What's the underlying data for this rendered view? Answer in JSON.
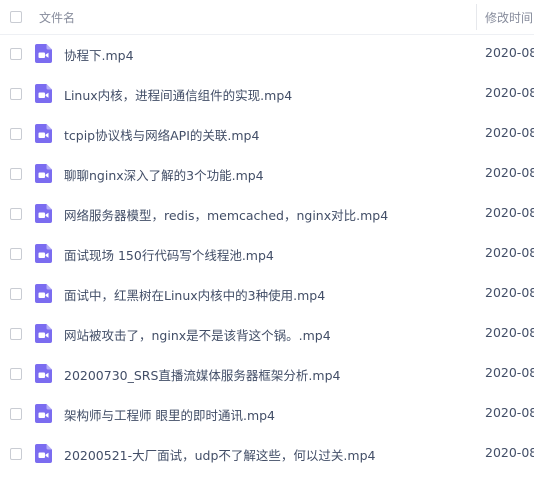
{
  "header": {
    "name_label": "文件名",
    "time_label": "修改时间"
  },
  "colors": {
    "video_icon": "#7b6cf0",
    "text": "#424e67",
    "header_text": "#878c9c"
  },
  "files": [
    {
      "name": "协程下.mp4",
      "modified": "2020-08-",
      "icon": "video-file-icon"
    },
    {
      "name": "Linux内核，进程间通信组件的实现.mp4",
      "modified": "2020-08-",
      "icon": "video-file-icon"
    },
    {
      "name": "tcpip协议栈与网络API的关联.mp4",
      "modified": "2020-08-",
      "icon": "video-file-icon"
    },
    {
      "name": "聊聊nginx深入了解的3个功能.mp4",
      "modified": "2020-08-",
      "icon": "video-file-icon"
    },
    {
      "name": "网络服务器模型，redis，memcached，nginx对比.mp4",
      "modified": "2020-08-",
      "icon": "video-file-icon"
    },
    {
      "name": "面试现场 150行代码写个线程池.mp4",
      "modified": "2020-08-",
      "icon": "video-file-icon"
    },
    {
      "name": "面试中，红黑树在Linux内核中的3种使用.mp4",
      "modified": "2020-08-",
      "icon": "video-file-icon"
    },
    {
      "name": "网站被攻击了，nginx是不是该背这个锅。.mp4",
      "modified": "2020-08-",
      "icon": "video-file-icon"
    },
    {
      "name": "20200730_SRS直播流媒体服务器框架分析.mp4",
      "modified": "2020-08-",
      "icon": "video-file-icon"
    },
    {
      "name": "架构师与工程师 眼里的即时通讯.mp4",
      "modified": "2020-08-",
      "icon": "video-file-icon"
    },
    {
      "name": "20200521-大厂面试，udp不了解这些，何以过关.mp4",
      "modified": "2020-08-",
      "icon": "video-file-icon"
    }
  ]
}
